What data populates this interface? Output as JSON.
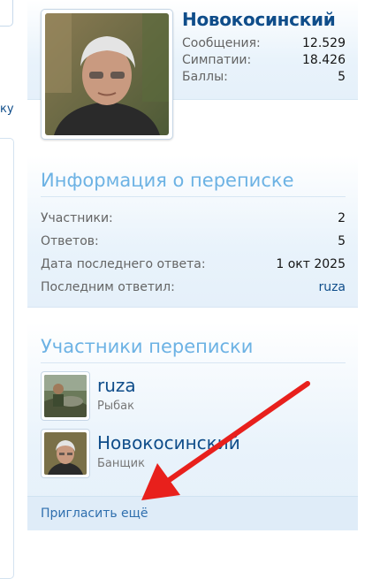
{
  "left_column": {
    "link_text": "ку"
  },
  "profile": {
    "name": "Новокосинский",
    "stats": [
      {
        "label": "Сообщения:",
        "value": "12.529"
      },
      {
        "label": "Симпатии:",
        "value": "18.426"
      },
      {
        "label": "Баллы:",
        "value": "5"
      }
    ]
  },
  "thread_info": {
    "heading": "Информация о переписке",
    "rows": [
      {
        "label": "Участники:",
        "value": "2"
      },
      {
        "label": "Ответов:",
        "value": "5"
      },
      {
        "label": "Дата последнего ответа:",
        "value": "1 окт 2025"
      },
      {
        "label": "Последним ответил:",
        "value": "ruza"
      }
    ]
  },
  "participants": {
    "heading": "Участники переписки",
    "list": [
      {
        "name": "ruza",
        "title": "Рыбак"
      },
      {
        "name": "Новокосинский",
        "title": "Банщик"
      }
    ],
    "invite_label": "Пригласить ещё"
  },
  "colors": {
    "link": "#0f4d8a",
    "heading": "#6cb2e4",
    "annotation_arrow": "#e8201c"
  }
}
